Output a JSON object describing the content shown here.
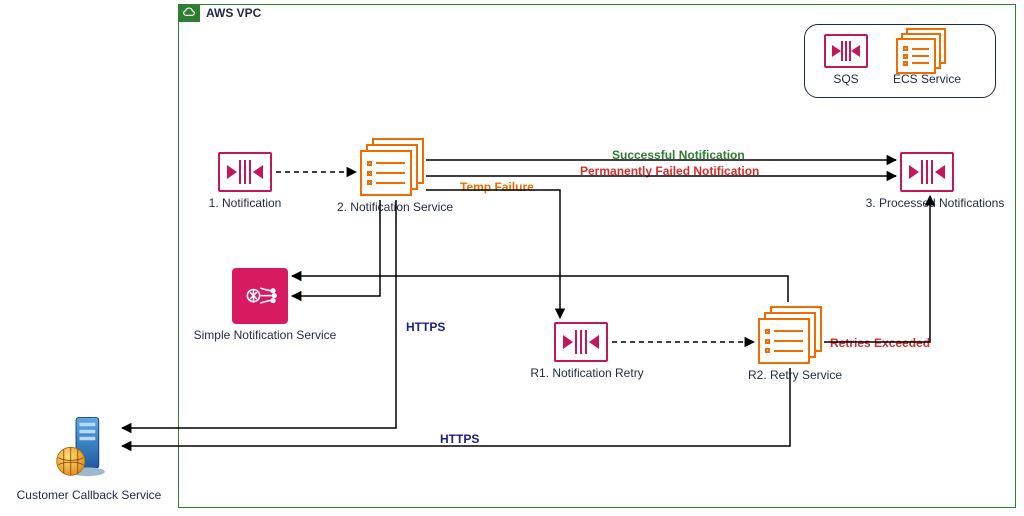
{
  "vpc": {
    "title": "AWS VPC"
  },
  "legend": {
    "sqs": "SQS",
    "ecs": "ECS Service"
  },
  "nodes": {
    "n1_label": "1. Notification",
    "n2_label": "2. Notification Service",
    "n3_label": "3. Processed Notifications",
    "r1_label": "R1. Notification Retry",
    "r2_label": "R2. Retry Service",
    "sns_label": "Simple Notification Service",
    "callback_label": "Customer Callback Service"
  },
  "edges": {
    "success": "Successful Notification",
    "perm_fail": "Permanently Failed Notification",
    "temp_fail": "Temp Failure",
    "retries_exceeded": "Retries Exceeded",
    "https1": "HTTPS",
    "https2": "HTTPS"
  },
  "colors": {
    "vpc_border": "#2e7d32",
    "sqs": "#c2185b",
    "ecs": "#ef6c00",
    "sns_bg": "#d81b60",
    "text": "#1f2a44",
    "success": "#2e7d32",
    "fail": "#d32f2f",
    "temp": "#ef6c00",
    "https": "#1a237e",
    "arrow": "#000000"
  },
  "chart_data": {
    "type": "diagram",
    "title": "AWS VPC",
    "container": "AWS VPC",
    "nodes": [
      {
        "id": "n1",
        "label": "1. Notification",
        "type": "SQS"
      },
      {
        "id": "n2",
        "label": "2. Notification Service",
        "type": "ECS Service"
      },
      {
        "id": "n3",
        "label": "3. Processed Notifications",
        "type": "SQS"
      },
      {
        "id": "r1",
        "label": "R1. Notification Retry",
        "type": "SQS"
      },
      {
        "id": "r2",
        "label": "R2. Retry Service",
        "type": "ECS Service"
      },
      {
        "id": "sns",
        "label": "Simple Notification Service",
        "type": "SNS"
      },
      {
        "id": "ccs",
        "label": "Customer Callback Service",
        "type": "External Server"
      }
    ],
    "edges": [
      {
        "from": "n1",
        "to": "n2",
        "label": "",
        "style": "dashed"
      },
      {
        "from": "n2",
        "to": "n3",
        "label": "Successful Notification",
        "style": "solid"
      },
      {
        "from": "n2",
        "to": "n3",
        "label": "Permanently Failed Notification",
        "style": "solid"
      },
      {
        "from": "n2",
        "to": "r1",
        "label": "Temp Failure",
        "style": "solid"
      },
      {
        "from": "n2",
        "to": "sns",
        "label": "",
        "style": "solid"
      },
      {
        "from": "n2",
        "to": "ccs",
        "label": "HTTPS",
        "style": "solid"
      },
      {
        "from": "r1",
        "to": "r2",
        "label": "",
        "style": "dashed"
      },
      {
        "from": "r2",
        "to": "n3",
        "label": "Retries Exceeded",
        "style": "solid"
      },
      {
        "from": "r2",
        "to": "sns",
        "label": "",
        "style": "solid"
      },
      {
        "from": "r2",
        "to": "ccs",
        "label": "HTTPS",
        "style": "solid"
      }
    ],
    "legend": [
      {
        "icon": "SQS",
        "label": "SQS"
      },
      {
        "icon": "ECS Service",
        "label": "ECS Service"
      }
    ]
  }
}
